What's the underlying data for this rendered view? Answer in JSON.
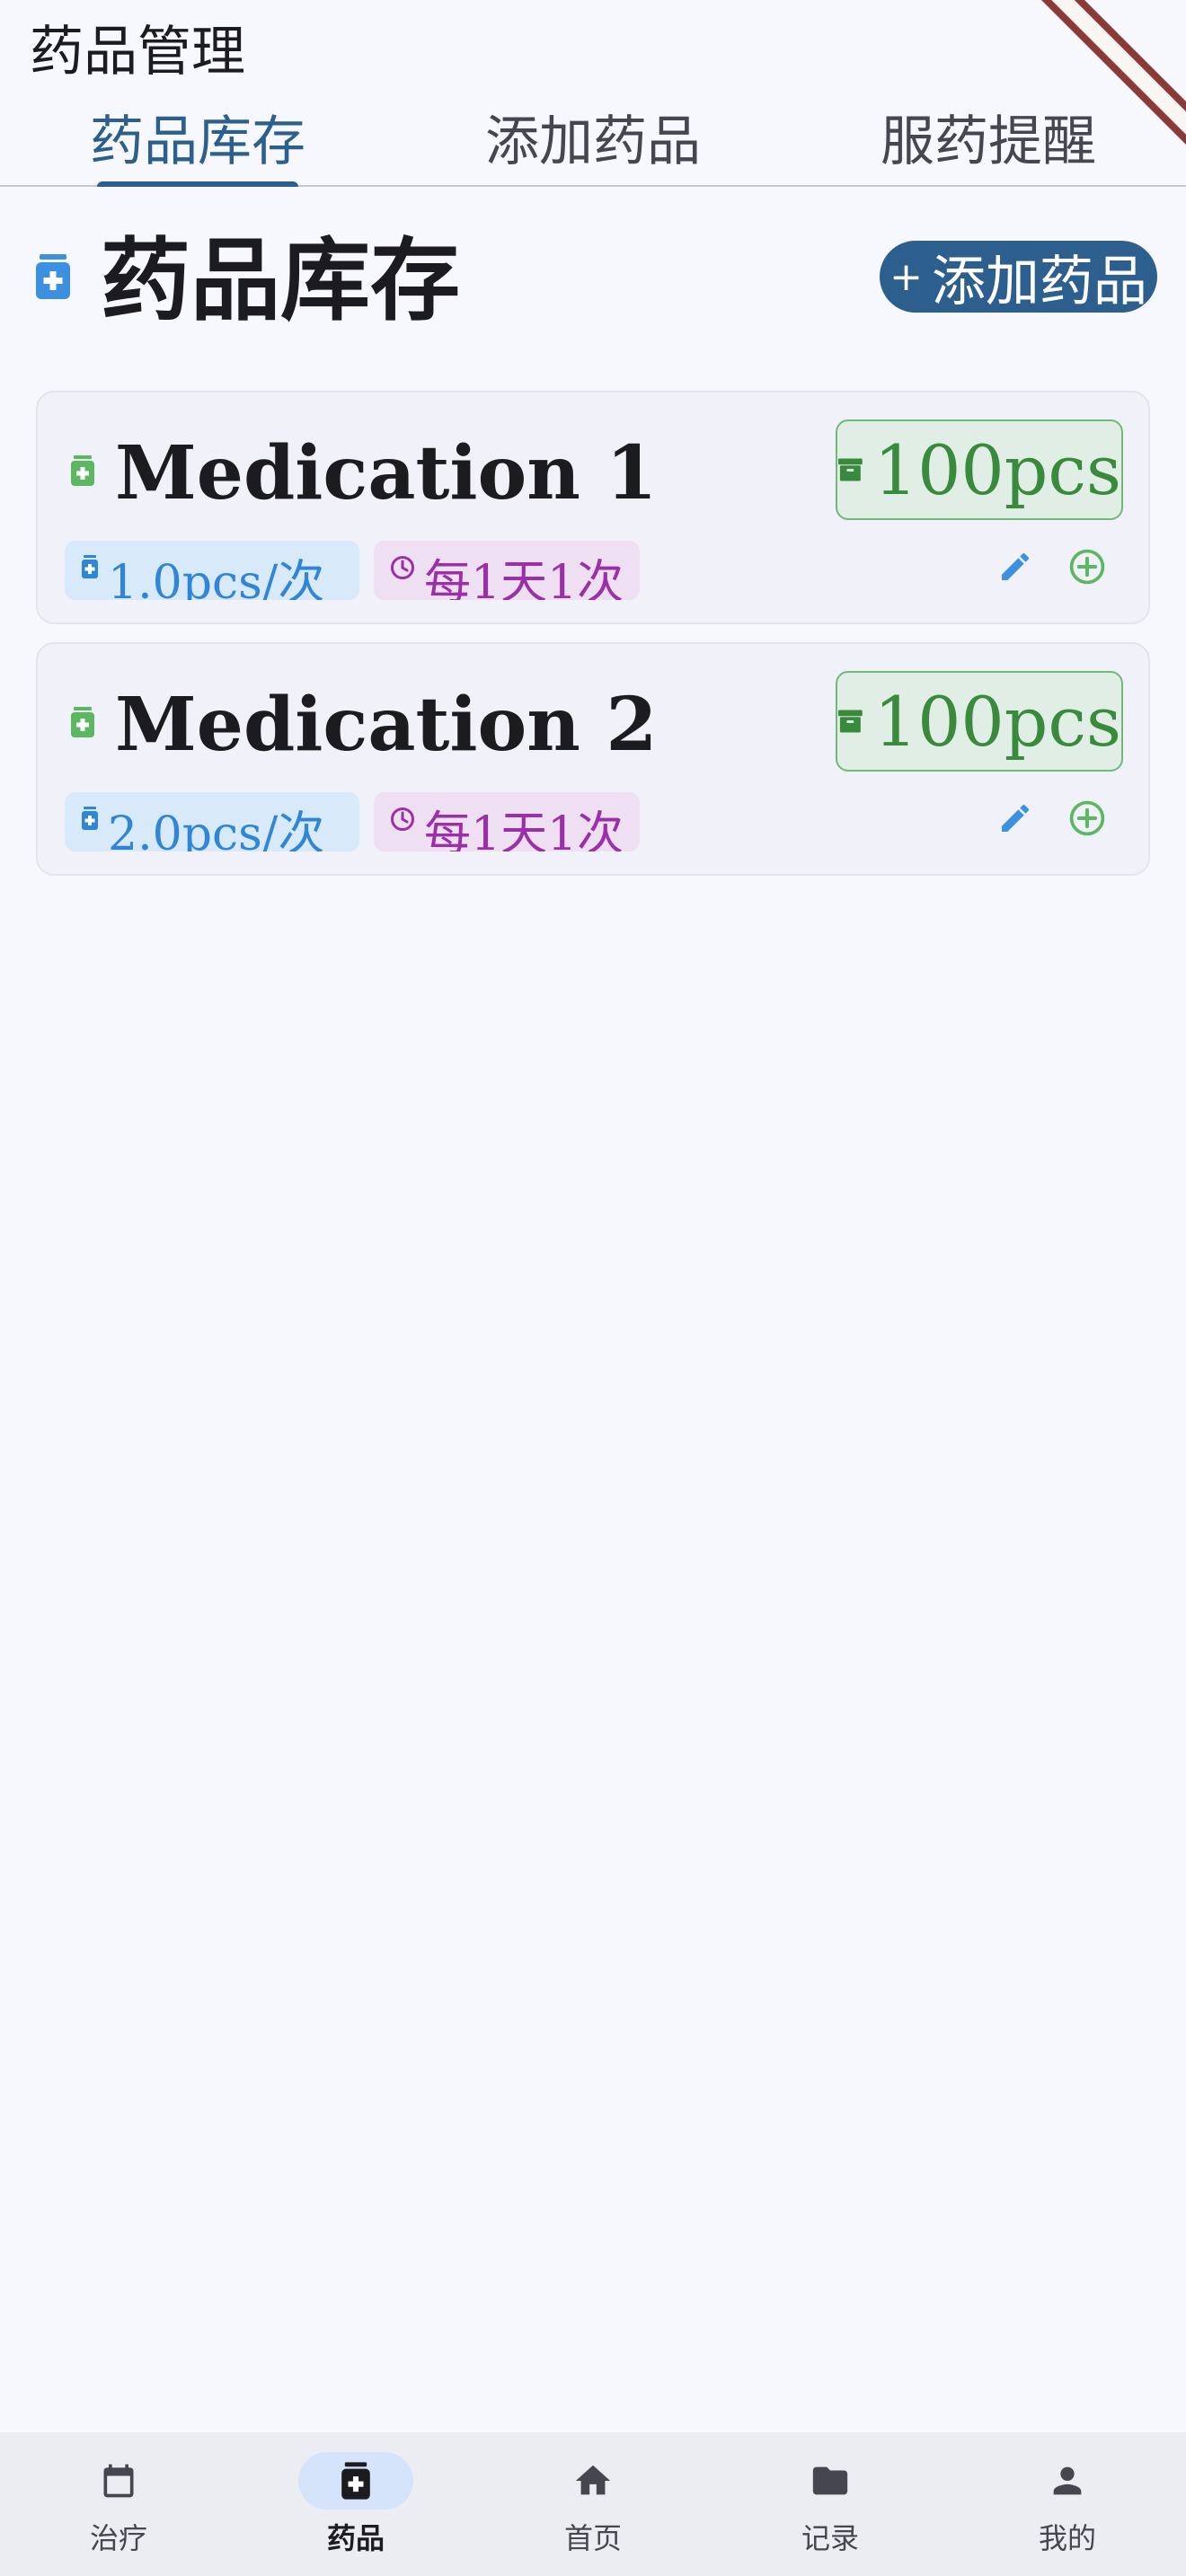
{
  "app_bar": {
    "title": "药品管理"
  },
  "tabs": [
    {
      "label": "药品库存",
      "active": true
    },
    {
      "label": "添加药品",
      "active": false
    },
    {
      "label": "服药提醒",
      "active": false
    }
  ],
  "section": {
    "title": "药品库存",
    "icon": "medication-bottle-icon",
    "add_button_label": "添加药品",
    "add_button_icon": "plus-icon"
  },
  "medications": [
    {
      "name": "Medication 1",
      "stock": "100pcs",
      "dose": "1.0pcs/次",
      "frequency": "每1天1次"
    },
    {
      "name": "Medication 2",
      "stock": "100pcs",
      "dose": "2.0pcs/次",
      "frequency": "每1天1次"
    }
  ],
  "bottom_nav": [
    {
      "label": "治疗",
      "icon": "calendar-icon",
      "active": false
    },
    {
      "label": "药品",
      "icon": "medication-icon",
      "active": true
    },
    {
      "label": "首页",
      "icon": "home-icon",
      "active": false
    },
    {
      "label": "记录",
      "icon": "folder-icon",
      "active": false
    },
    {
      "label": "我的",
      "icon": "person-icon",
      "active": false
    }
  ],
  "colors": {
    "primary": "#2c5f8e",
    "background": "#f7f8fd",
    "stock_green": "#3a8a3e",
    "dose_blue": "#2f86d8",
    "frequency_purple": "#9b2ea9",
    "icon_green": "#5cb860"
  }
}
